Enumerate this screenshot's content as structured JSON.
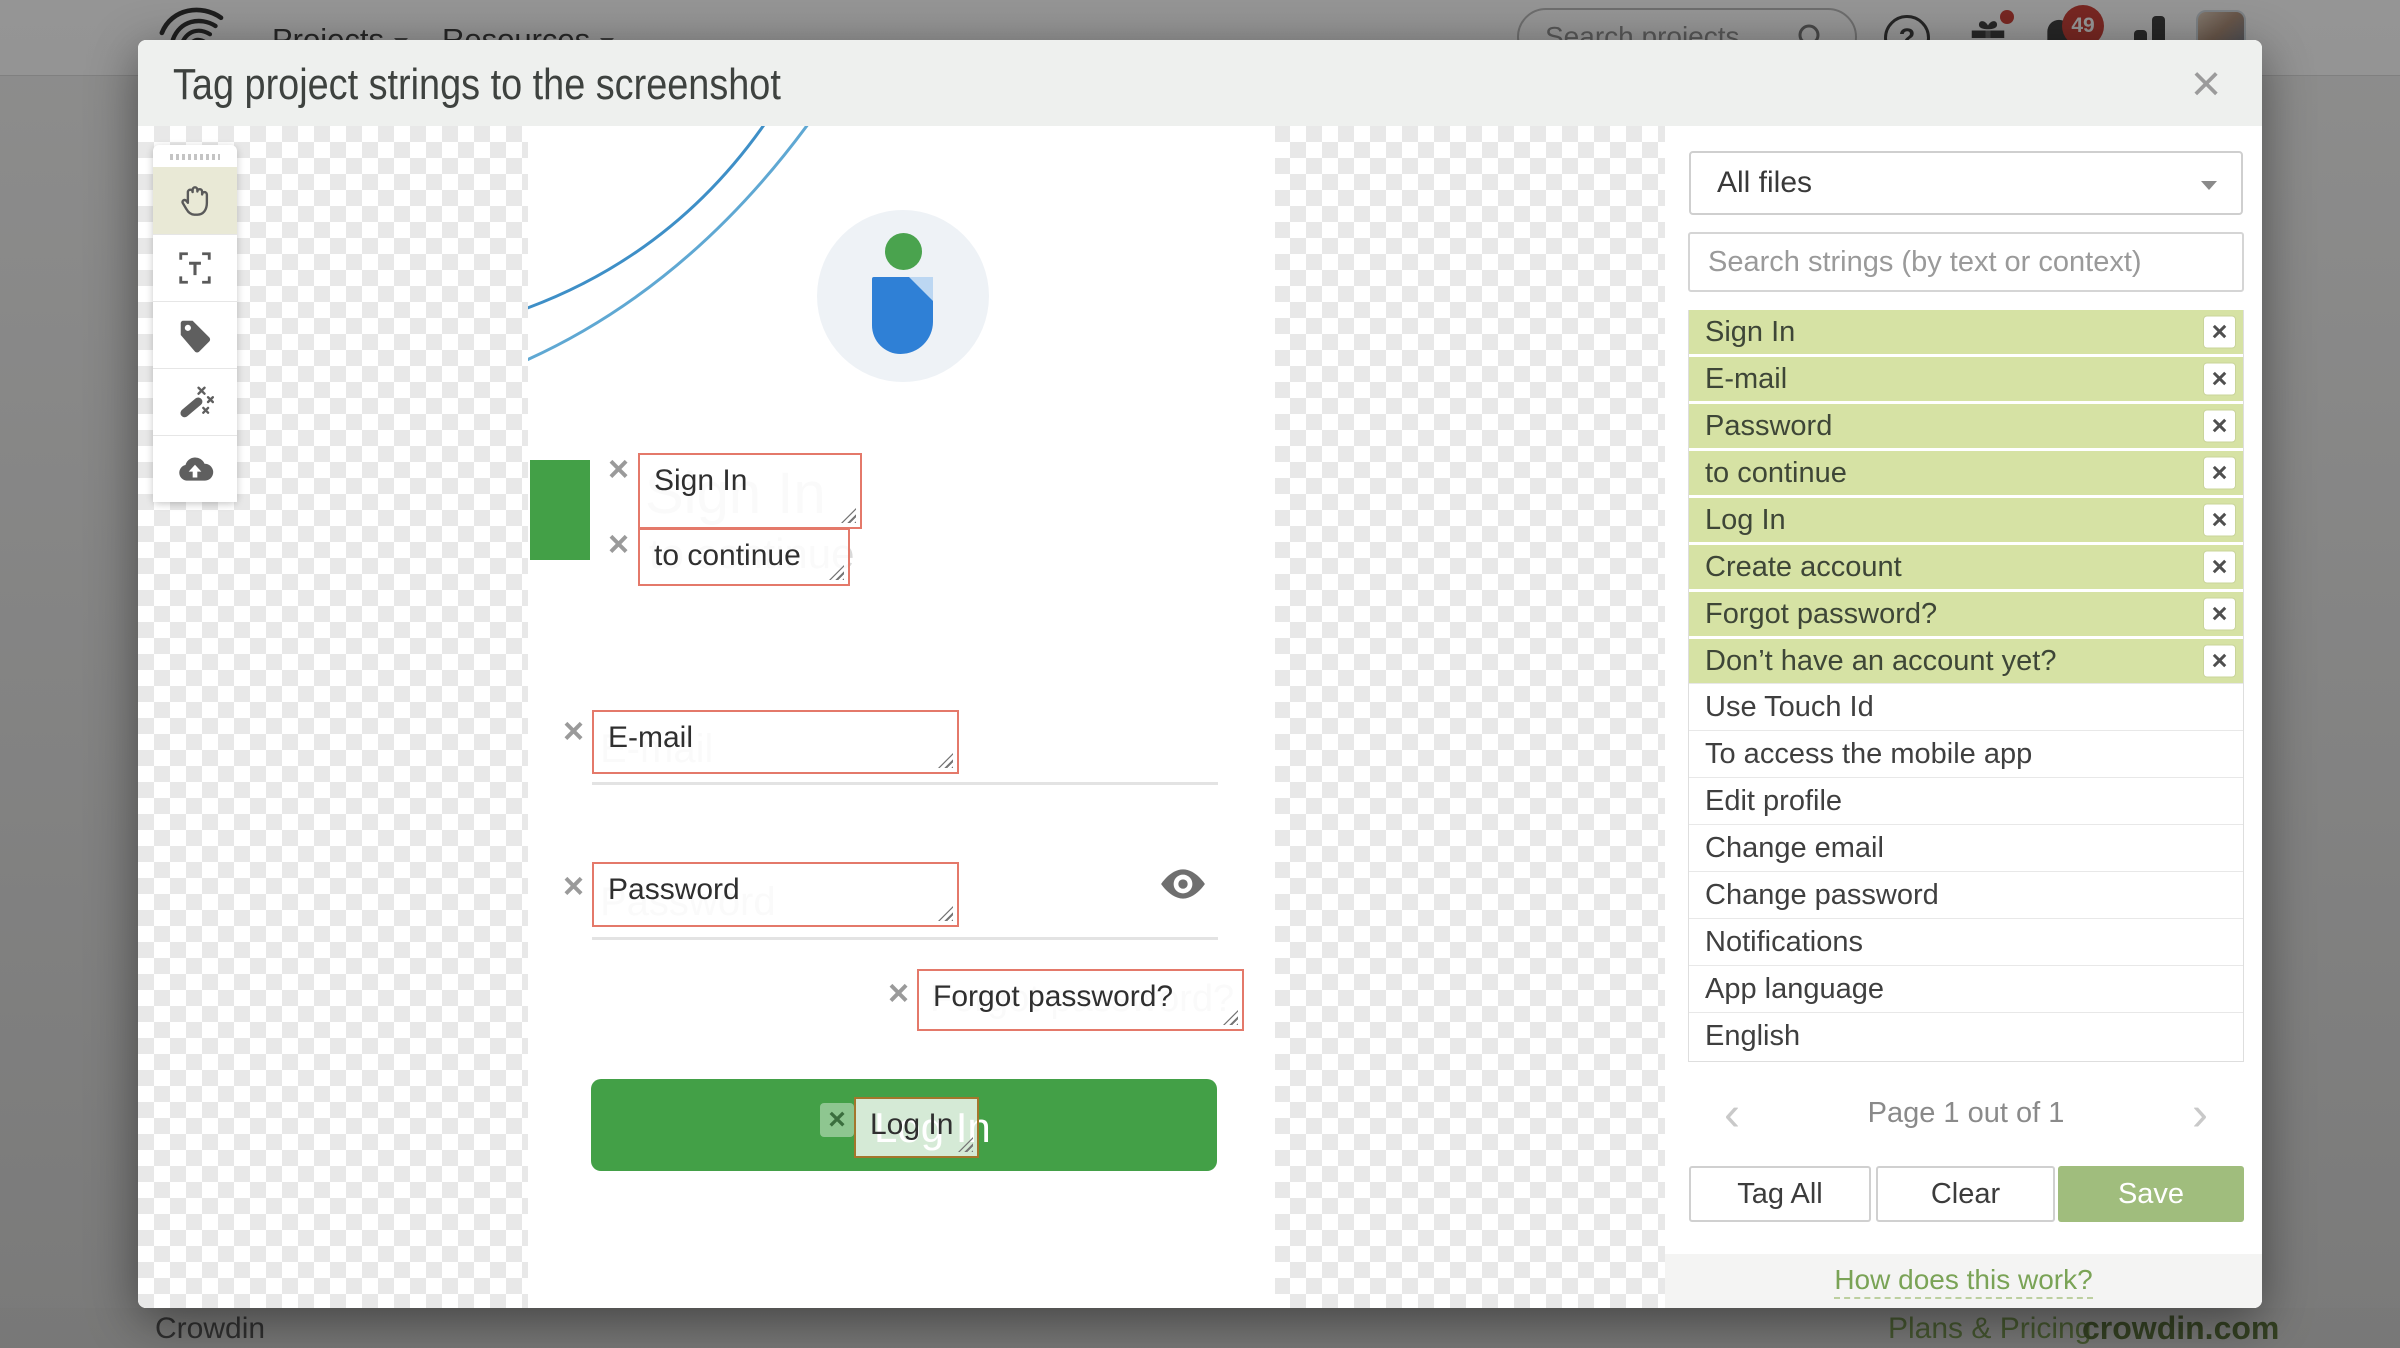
{
  "page": {
    "nav_projects": "Projects",
    "nav_resources": "Resources",
    "search_placeholder": "Search projects",
    "notification_count": "49",
    "footer_brand": "Crowdin",
    "footer_plans": "Plans & Pricing",
    "footer_site": "crowdin.com"
  },
  "modal": {
    "title": "Tag project strings to the screenshot",
    "toolbar_tools": [
      {
        "icon": "hand-pan-tool-icon"
      },
      {
        "icon": "text-select-tool-icon"
      },
      {
        "icon": "tag-tool-icon"
      },
      {
        "icon": "magic-wand-tool-icon"
      },
      {
        "icon": "cloud-upload-tool-icon"
      }
    ]
  },
  "screenshot": {
    "heading": "Sign In",
    "subheading": "to continue",
    "email_placeholder": "E-mail",
    "password_placeholder": "Password",
    "forgot_link": "Forgot password?",
    "login_button": "Log In"
  },
  "tags": [
    {
      "label": "Sign In"
    },
    {
      "label": "to continue"
    },
    {
      "label": "E-mail"
    },
    {
      "label": "Password"
    },
    {
      "label": "Forgot password?"
    },
    {
      "label": "Log In"
    }
  ],
  "panel": {
    "file_filter": "All files",
    "search_placeholder": "Search strings (by text or context)",
    "strings": [
      {
        "text": "Sign In",
        "tagged": true
      },
      {
        "text": "E-mail",
        "tagged": true
      },
      {
        "text": "Password",
        "tagged": true
      },
      {
        "text": "to continue",
        "tagged": true
      },
      {
        "text": "Log In",
        "tagged": true
      },
      {
        "text": "Create account",
        "tagged": true
      },
      {
        "text": "Forgot password?",
        "tagged": true
      },
      {
        "text": "Don’t have an account yet?",
        "tagged": true
      },
      {
        "text": "Use Touch Id",
        "tagged": false
      },
      {
        "text": "To access the mobile app",
        "tagged": false
      },
      {
        "text": "Edit profile",
        "tagged": false
      },
      {
        "text": "Change email",
        "tagged": false
      },
      {
        "text": "Change password",
        "tagged": false
      },
      {
        "text": "Notifications",
        "tagged": false
      },
      {
        "text": "App language",
        "tagged": false
      },
      {
        "text": "English",
        "tagged": false
      }
    ],
    "pagination": "Page 1 out of 1",
    "tag_all": "Tag All",
    "clear": "Clear",
    "save": "Save",
    "help": "How does this work?"
  },
  "glyphs": {
    "close": "×",
    "prev": "‹",
    "next": "›"
  },
  "colors": {
    "app_green": "#43a047",
    "tag_border": "#e4796a",
    "login_tag_border": "#a4762c",
    "tagged_row_bg": "#d6e2a4",
    "save_button_bg": "#a0bd7d",
    "link_green": "#7aa356",
    "badge_red": "#c62f26"
  }
}
